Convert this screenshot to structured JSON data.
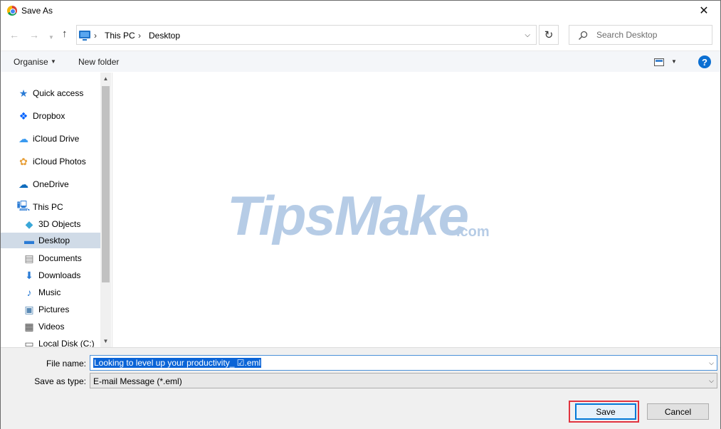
{
  "window": {
    "title": "Save As"
  },
  "nav": {
    "breadcrumb": [
      "This PC",
      "Desktop"
    ],
    "search_placeholder": "Search Desktop"
  },
  "toolbar": {
    "organise_label": "Organise",
    "new_folder_label": "New folder",
    "help_label": "?"
  },
  "sidebar": {
    "items": [
      {
        "label": "Quick access",
        "icon": "star-icon"
      },
      {
        "label": "Dropbox",
        "icon": "dropbox-icon"
      },
      {
        "label": "iCloud Drive",
        "icon": "icloud-icon"
      },
      {
        "label": "iCloud Photos",
        "icon": "photos-icon"
      },
      {
        "label": "OneDrive",
        "icon": "onedrive-icon"
      },
      {
        "label": "This PC",
        "icon": "pc-icon"
      },
      {
        "label": "3D Objects",
        "icon": "cube-icon"
      },
      {
        "label": "Desktop",
        "icon": "desktop-icon",
        "selected": true
      },
      {
        "label": "Documents",
        "icon": "document-icon"
      },
      {
        "label": "Downloads",
        "icon": "download-icon"
      },
      {
        "label": "Music",
        "icon": "music-icon"
      },
      {
        "label": "Pictures",
        "icon": "picture-icon"
      },
      {
        "label": "Videos",
        "icon": "video-icon"
      },
      {
        "label": "Local Disk (C:)",
        "icon": "disk-icon"
      }
    ]
  },
  "content": {
    "watermark_main": "TipsMake",
    "watermark_suffix": ".com"
  },
  "form": {
    "filename_label": "File name:",
    "filename_value": "Looking to level up your productivity_ ☑.eml",
    "savetype_label": "Save as type:",
    "savetype_value": "E-mail Message (*.eml)"
  },
  "buttons": {
    "save": "Save",
    "cancel": "Cancel"
  },
  "colors": {
    "accent": "#0078d7",
    "selection": "#0a64d7",
    "highlight": "#e1343f",
    "watermark": "#b6cce6"
  }
}
